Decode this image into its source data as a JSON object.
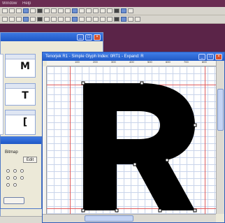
{
  "menubar": {
    "items": [
      "Window",
      "Help"
    ]
  },
  "toolbar": {
    "row1_icons": [
      "new-icon",
      "open-icon",
      "save-icon",
      "cut-icon",
      "copy-icon",
      "paste-icon",
      "undo-icon",
      "redo-icon",
      "grid-icon",
      "snap-icon",
      "zoom-in-icon",
      "zoom-out-icon",
      "pointer-icon",
      "pen-icon",
      "line-icon",
      "curve-icon",
      "ruler-icon",
      "fill-icon",
      "help-icon"
    ],
    "row2_icons": [
      "select-icon",
      "move-icon",
      "rotate-icon",
      "flip-icon",
      "scale-icon",
      "skew-icon",
      "align-left-icon",
      "align-center-icon",
      "align-right-icon",
      "distribute-icon",
      "node-icon",
      "corner-icon",
      "smooth-icon",
      "tangent-icon",
      "point-icon",
      "contour-icon",
      "hint-icon",
      "kerning-icon",
      "metrics-icon",
      "preview-icon"
    ]
  },
  "font_window": {
    "cells": [
      {
        "glyph": "M"
      },
      {
        "glyph": "T"
      },
      {
        "glyph": "["
      }
    ]
  },
  "bitmap_dialog": {
    "label": "Bitmap",
    "edit_value": "Edit"
  },
  "glyph_window": {
    "title": "Tenorjek R1 - Simple Glyph Index: 0RT1 - Expand: R",
    "glyph": "R",
    "ruler_ticks": [
      "100",
      "200",
      "300",
      "400",
      "500",
      "600",
      "700",
      "800",
      "900"
    ],
    "guide_color": "#e05c5c",
    "grid_color": "#c9d4ea"
  },
  "colors": {
    "desktop": "#5b2448",
    "titlebar": "#2159c4",
    "window_bg": "#ece9d8"
  }
}
